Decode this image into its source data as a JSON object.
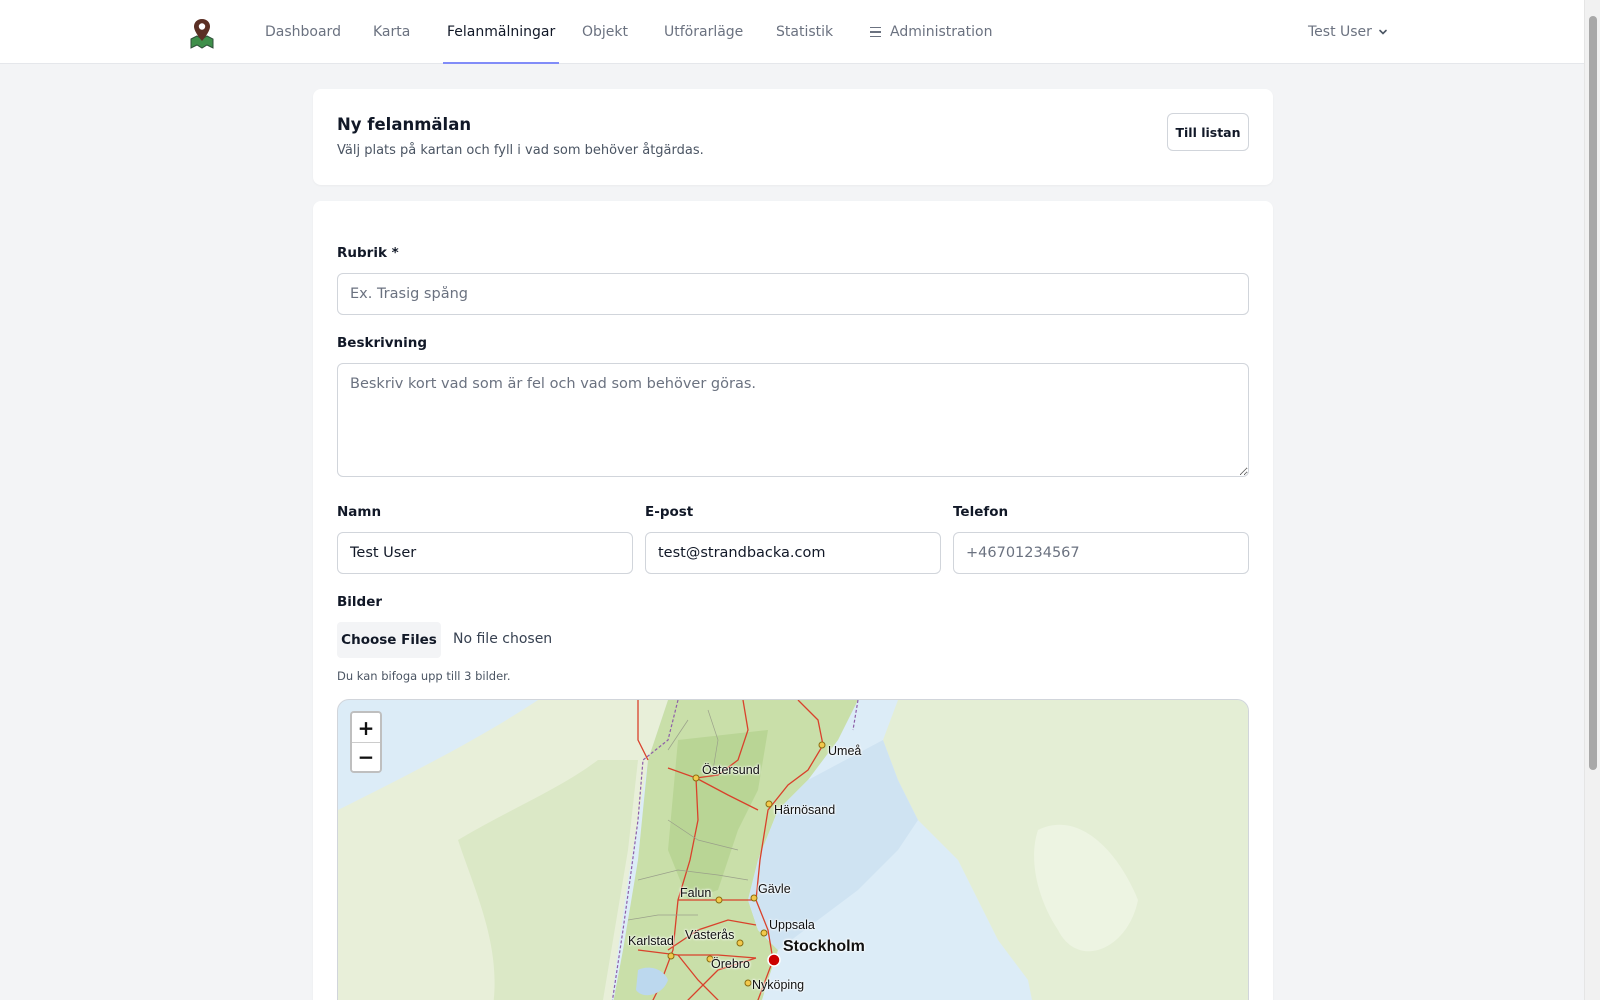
{
  "nav": {
    "items": [
      {
        "label": "Dashboard",
        "active": false
      },
      {
        "label": "Karta",
        "active": false
      },
      {
        "label": "Felanmälningar",
        "active": true
      },
      {
        "label": "Objekt",
        "active": false
      },
      {
        "label": "Utförarläge",
        "active": false
      },
      {
        "label": "Statistik",
        "active": false
      }
    ],
    "admin_label": "Administration",
    "user_label": "Test User",
    "accent_color": "#818cf8"
  },
  "header": {
    "title": "Ny felanmälan",
    "subtitle": "Välj plats på kartan och fyll i vad som behöver åtgärdas.",
    "back_button": "Till listan"
  },
  "form": {
    "rubrik": {
      "label": "Rubrik *",
      "value": "",
      "placeholder": "Ex. Trasig spång"
    },
    "beskrivning": {
      "label": "Beskrivning",
      "value": "",
      "placeholder": "Beskriv kort vad som är fel och vad som behöver göras."
    },
    "namn": {
      "label": "Namn",
      "value": "Test User",
      "placeholder": ""
    },
    "epost": {
      "label": "E-post",
      "value": "test@strandbacka.com",
      "placeholder": ""
    },
    "telefon": {
      "label": "Telefon",
      "value": "",
      "placeholder": "+46701234567"
    },
    "bilder": {
      "label": "Bilder",
      "button": "Choose Files",
      "status": "No file chosen",
      "hint": "Du kan bifoga upp till 3 bilder."
    }
  },
  "map": {
    "zoom_in": "+",
    "zoom_out": "−",
    "cities": [
      "Umeå",
      "Östersund",
      "Härnösand",
      "Gävle",
      "Falun",
      "Uppsala",
      "Västerås",
      "Karlstad",
      "Stockholm",
      "Örebro",
      "Nyköping"
    ],
    "marker_color": "#cc0000"
  }
}
